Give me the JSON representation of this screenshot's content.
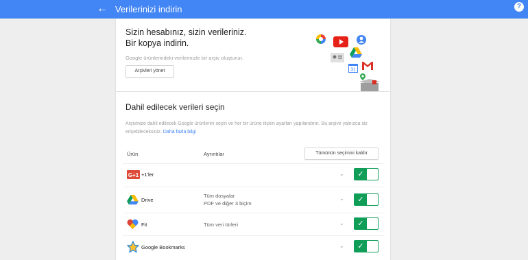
{
  "topbar": {
    "title": "Verilerinizi indirin",
    "back_icon": "arrow-left-icon",
    "help_icon": "help-icon",
    "color": "#4285f4"
  },
  "intro": {
    "heading_line1": "Sizin hesabınız, sizin verileriniz.",
    "heading_line2": "Bir kopya indirin.",
    "description": "Google ürünlerindeki verilerinizle bir arşiv oluşturun.",
    "manage_button": "Arşivleri yönet"
  },
  "select": {
    "heading": "Dahil edilecek verileri seçin",
    "description": "Arşivinize dahil edilecek Google ürünlerini seçin ve her bir ürüne ilişkin ayarları yapılandırın. Bu arşive yalnızca siz erişebileceksiniz.",
    "learn_more": "Daha fazla bilgi",
    "col_product": "Ürün",
    "col_details": "Ayrıntılar",
    "deselect_all": "Tümünün seçimini kaldır"
  },
  "products": [
    {
      "name": "+1'ler",
      "detail1": "",
      "detail2": "",
      "icon": "google-plus-one-icon",
      "selected": true
    },
    {
      "name": "Drive",
      "detail1": "Tüm dosyalar",
      "detail2": "PDF ve diğer 3 biçim",
      "icon": "google-drive-icon",
      "selected": true
    },
    {
      "name": "Fit",
      "detail1": "Tüm veri türleri",
      "detail2": "",
      "icon": "google-fit-icon",
      "selected": true
    },
    {
      "name": "Google Bookmarks",
      "detail1": "",
      "detail2": "",
      "icon": "bookmarks-star-icon",
      "selected": true
    }
  ],
  "toggle_color": "#0f9d58",
  "link_color": "#4285f4"
}
